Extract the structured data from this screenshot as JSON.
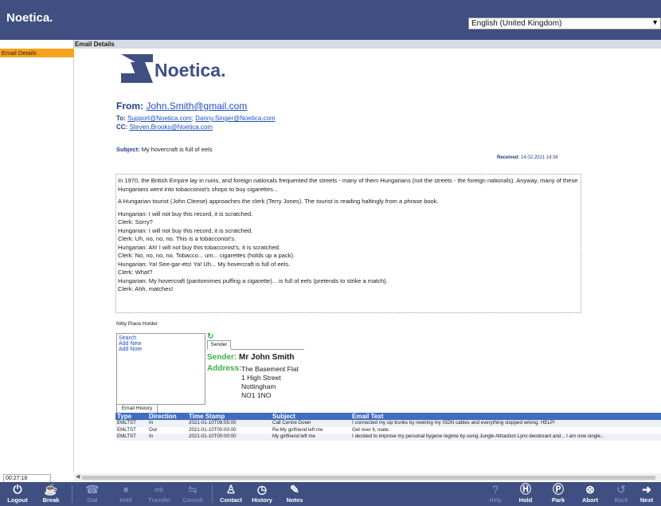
{
  "header": {
    "brand": "Noetica.",
    "language": "English (United Kingdom)"
  },
  "sidebar": {
    "items": [
      {
        "label": "Email Details"
      }
    ]
  },
  "content": {
    "title": "Email Details"
  },
  "email": {
    "logo_text": "Noetica.",
    "from_label": "From:",
    "from": "John.Smith@gmail.com",
    "to_label": "To:",
    "to_1": "Support@Noetica.com",
    "to_2": "Danny.Singer@Noetica.com",
    "cc_label": "CC:",
    "cc": "Steven.Brooks@Noetica.com",
    "subject_label": "Subject:",
    "subject": "My hovercraft is full of eels",
    "received_label": "Received:",
    "received": "14.02.2021 14:34",
    "body": [
      "In 1970, the British Empire lay in ruins, and foreign nationals frequented the streets - many of them Hungarians (not the streets - the foreign nationals). Anyway, many of these Hungarians went into tobacconist's shops to buy cigarettes...",
      "A Hungarian tourist (John Cleese) approaches the clerk (Terry Jones). The tourist is reading haltingly from a phrase book.",
      "Hungarian: I will not buy this record, it is scratched.\nClerk: Sorry?\nHungarian: I will not buy this record, it is scratched.\nClerk: Uh, no, no, no. This is a tobacconist's.\nHungarian: Ah! I will not buy this tobacconist's, it is scratched.\nClerk: No, no, no, no. Tobacco... um... cigarettes (holds up a pack).\nHungarian: Ya! See-gar-ets! Ya! Uh... My hovercraft is full of eels.\nClerk: What?\nHungarian: My hovercraft (pantomimes puffing a cigarette)... is full of eels (pretends to strike a match).\nClerk: Ahh, matches!"
    ]
  },
  "nitty": "Nitty Place Holder",
  "actions": {
    "search": "Search",
    "add_new": "Add New",
    "add_note": "Add Note"
  },
  "sender": {
    "tab": "Sender",
    "name_label": "Sender:",
    "name": "Mr John Smith",
    "address_label": "Address:",
    "address": [
      "The Basement Flat",
      "1 High Street",
      "Nottingham",
      "NO1 1NO"
    ]
  },
  "history": {
    "tab": "Email History",
    "columns": [
      "Type",
      "Direction",
      "Time Stamp",
      "Subject",
      "Email Text"
    ],
    "rows": [
      [
        "EMLTST",
        "In",
        "2021-01-10T08:55:00",
        "Call Centre Down",
        "I connected my sip trunks by rewiring my ISDN cables and everything stopped wrking. HELP!"
      ],
      [
        "EMLTST",
        "Out",
        "2021-01-10T00:00:00",
        "Re:My girlfriend left me",
        "Get over it, mate."
      ],
      [
        "EMLTST",
        "In",
        "2021-01-10T00:00:00",
        "My girlfriend left me",
        "I decided to improve my personal hygene regime by using Jungle Attraction Lynx deodorant and... I am now single..."
      ]
    ]
  },
  "timer": "00:27:18",
  "toolbar": {
    "logout": "Logout",
    "break": "Break",
    "dial": "Dial",
    "hold": "Hold",
    "transfer": "Transfer",
    "consult": "Consult",
    "contact": "Contact",
    "history": "History",
    "notes": "Notes",
    "help": "Help",
    "hold2": "Hold",
    "park": "Park",
    "abort": "Abort",
    "back": "Back",
    "next": "Next"
  },
  "colors": {
    "topbar": "#3f4f82",
    "accent": "#f7a21b",
    "link": "#1f4fbf",
    "green": "#3cb043"
  }
}
